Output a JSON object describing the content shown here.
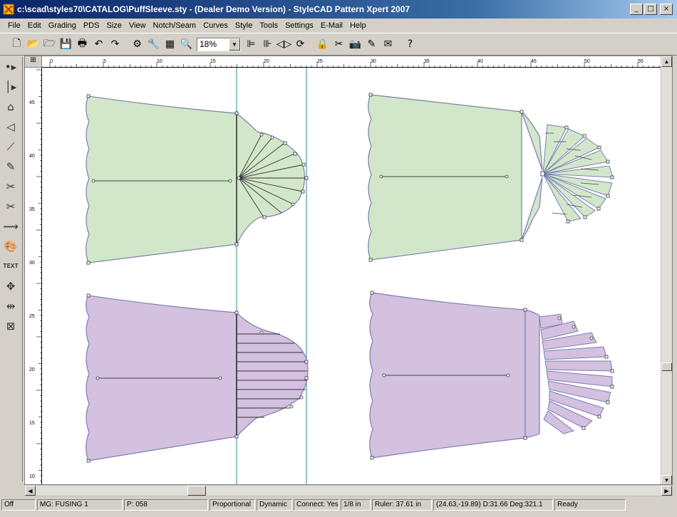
{
  "window": {
    "title": "c:\\scad\\styles70\\CATALOG\\PuffSleeve.sty - (Dealer Demo Version) - StyleCAD Pattern Xpert 2007"
  },
  "menu": [
    "File",
    "Edit",
    "Grading",
    "PDS",
    "Size",
    "View",
    "Notch/Seam",
    "Curves",
    "Style",
    "Tools",
    "Settings",
    "E-Mail",
    "Help"
  ],
  "toolbar": {
    "zoom": "18%"
  },
  "left_tools": {
    "text_tool": "TEXT"
  },
  "ruler": {
    "h_labels": [
      "0",
      "5",
      "10",
      "15",
      "20",
      "25",
      "30",
      "35",
      "40",
      "45",
      "50",
      "55"
    ],
    "v_labels": [
      "45",
      "40",
      "35",
      "30",
      "25",
      "20",
      "15",
      "10"
    ]
  },
  "colors": {
    "green_fill": "#d2e7c9",
    "purple_fill": "#d4c0df",
    "outline": "#7a7fb5",
    "guide": "#2d8a8a"
  },
  "status": {
    "snap": "Off",
    "mg": "MG: FUSING 1",
    "p": "P: 058",
    "mode1": "Proportional",
    "mode2": "Dynamic",
    "connect": "Connect: Yes",
    "precision": "1/8 in",
    "ruler": "Ruler: 37.61 in",
    "coords": "(24.63,-19.89) D:31.66 Deg:321.1",
    "ready": "Ready"
  }
}
